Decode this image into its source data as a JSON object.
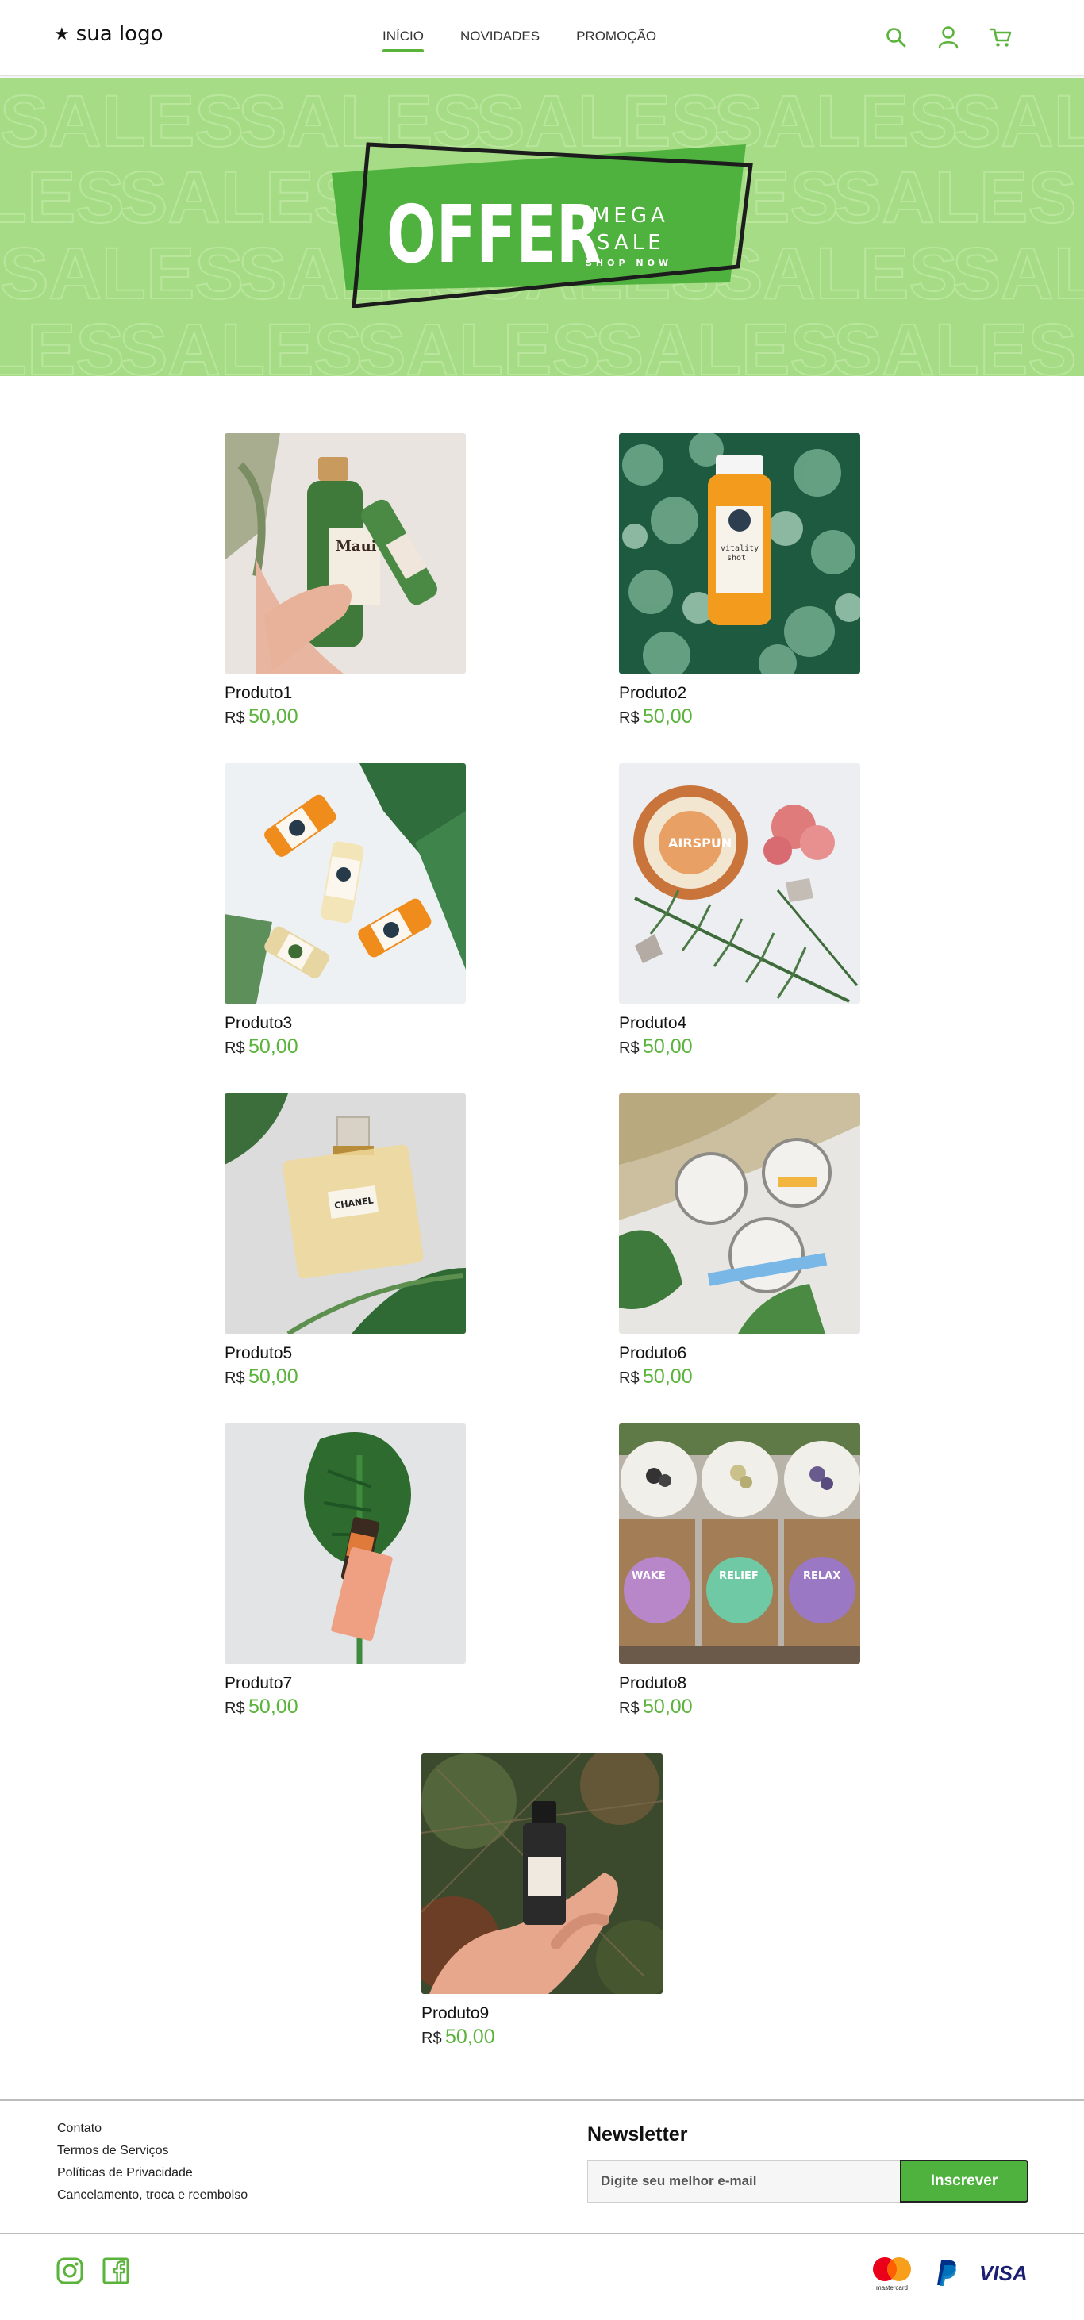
{
  "brand": {
    "logo_text": "sua logo",
    "logo_icon": "star-icon"
  },
  "nav": [
    {
      "label": "INÍCIO",
      "active": true
    },
    {
      "label": "NOVIDADES",
      "active": false
    },
    {
      "label": "PROMOÇÃO",
      "active": false
    }
  ],
  "header_icons": [
    "search-icon",
    "user-icon",
    "cart-icon"
  ],
  "banner": {
    "background_word": "SALES",
    "offer": "OFFER",
    "mega": "MEGA",
    "sale": "SALE",
    "shop_now": "SHOP NOW"
  },
  "products": [
    {
      "name": "Produto1",
      "currency": "R$",
      "price": "50,00"
    },
    {
      "name": "Produto2",
      "currency": "R$",
      "price": "50,00"
    },
    {
      "name": "Produto3",
      "currency": "R$",
      "price": "50,00"
    },
    {
      "name": "Produto4",
      "currency": "R$",
      "price": "50,00"
    },
    {
      "name": "Produto5",
      "currency": "R$",
      "price": "50,00"
    },
    {
      "name": "Produto6",
      "currency": "R$",
      "price": "50,00"
    },
    {
      "name": "Produto7",
      "currency": "R$",
      "price": "50,00"
    },
    {
      "name": "Produto8",
      "currency": "R$",
      "price": "50,00"
    },
    {
      "name": "Produto9",
      "currency": "R$",
      "price": "50,00"
    }
  ],
  "footer": {
    "links": [
      "Contato",
      "Termos de Serviços",
      "Políticas de Privacidade",
      "Cancelamento, troca e reembolso"
    ],
    "newsletter_title": "Newsletter",
    "newsletter_placeholder": "Digite seu melhor e-mail",
    "newsletter_button": "Inscrever",
    "social": [
      "instagram-icon",
      "facebook-icon"
    ],
    "payments": {
      "mastercard": "mastercard",
      "paypal": "paypal-icon",
      "visa": "VISA"
    }
  },
  "colors": {
    "accent": "#5ab33a",
    "banner_bg": "#a6dc85",
    "offer_green": "#4fb23f"
  }
}
